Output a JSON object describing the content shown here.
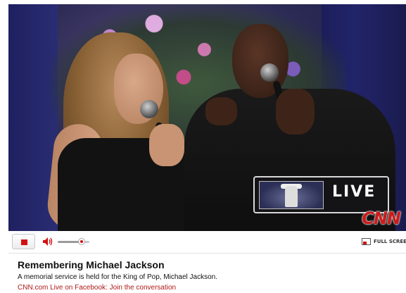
{
  "player": {
    "live_label": "LIVE",
    "network_logo": "CNN",
    "thumbnail_icon": "dancer-silhouette-icon"
  },
  "controls": {
    "stop_icon": "stop-icon",
    "volume_icon": "speaker-icon",
    "volume_level": 0.75,
    "fullscreen_icon": "fullscreen-icon",
    "fullscreen_label": "FULL SCREEN"
  },
  "caption": {
    "title": "Remembering Michael Jackson",
    "description": "A memorial service is held for the King of Pop, Michael Jackson.",
    "link_text": "CNN.com Live on Facebook: Join the conversation"
  },
  "colors": {
    "accent_red": "#cc1b1b",
    "link_red": "#b01818",
    "text": "#111111"
  }
}
